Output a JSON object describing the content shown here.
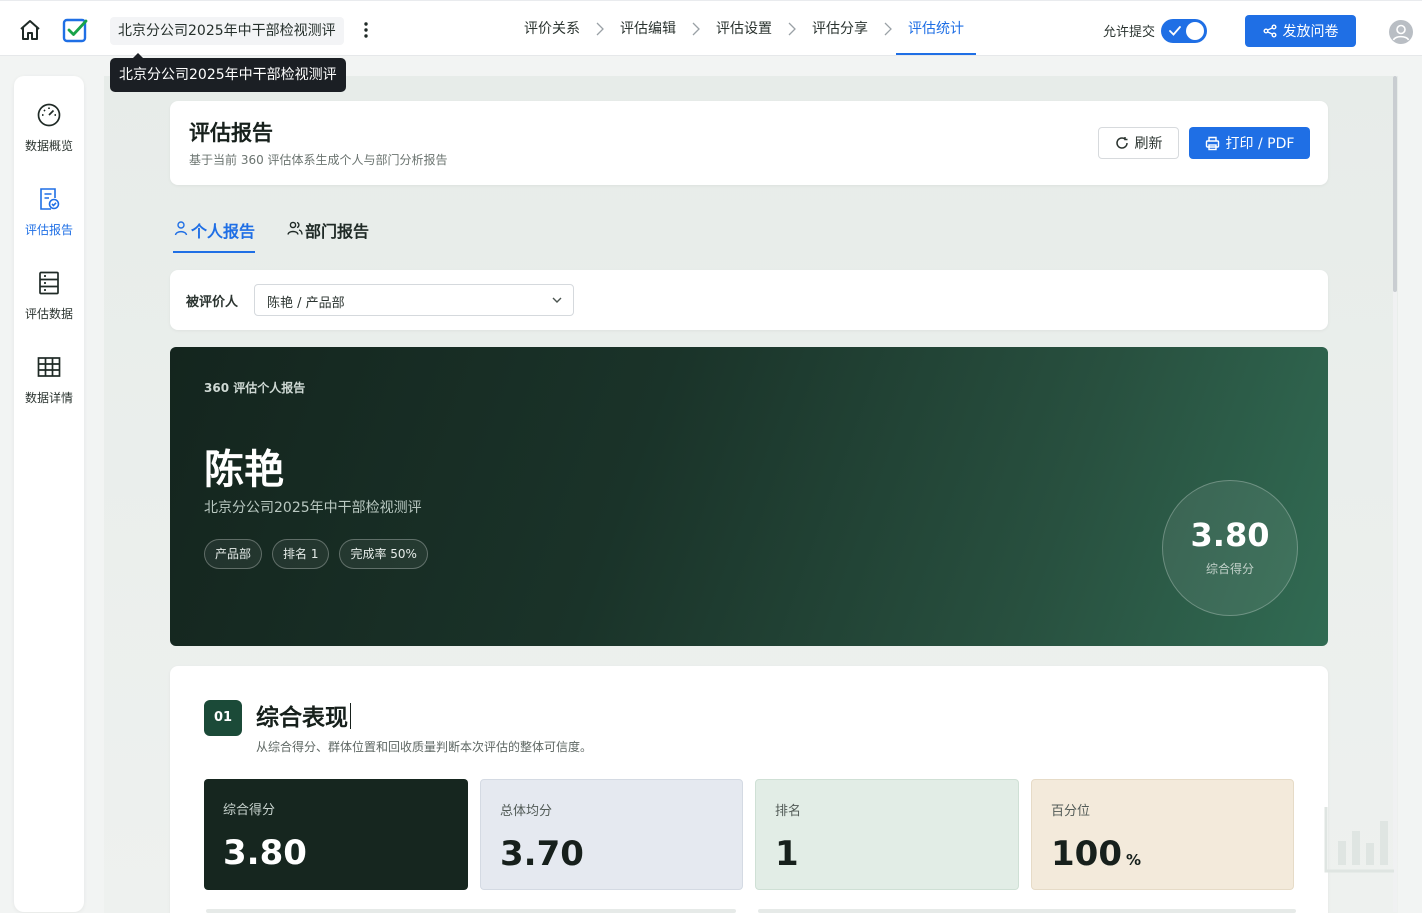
{
  "header": {
    "doc_title": "北京分公司2025年中干部检视测评",
    "steps": [
      "评价关系",
      "评估编辑",
      "评估设置",
      "评估分享",
      "评估统计"
    ],
    "active_step": 4,
    "allow_submit_label": "允许提交",
    "allow_submit_on": true,
    "publish_label": "发放问卷"
  },
  "tooltip": {
    "text": "北京分公司2025年中干部检视测评"
  },
  "sidebar": {
    "items": [
      {
        "label": "数据概览",
        "icon": "gauge-icon"
      },
      {
        "label": "评估报告",
        "icon": "report-icon",
        "active": true
      },
      {
        "label": "评估数据",
        "icon": "data-list-icon"
      },
      {
        "label": "数据详情",
        "icon": "grid-table-icon"
      }
    ]
  },
  "report": {
    "title": "评估报告",
    "subtitle": "基于当前 360 评估体系生成个人与部门分析报告",
    "refresh_label": "刷新",
    "print_label": "打印 / PDF"
  },
  "tabs": [
    {
      "label": "个人报告",
      "active": true
    },
    {
      "label": "部门报告",
      "active": false
    }
  ],
  "filter": {
    "label": "被评价人",
    "selected": "陈艳 / 产品部"
  },
  "hero": {
    "eyebrow": "360 评估个人报告",
    "name": "陈艳",
    "project": "北京分公司2025年中干部检视测评",
    "chips": [
      "产品部",
      "排名 1",
      "完成率 50%"
    ],
    "score": "3.80",
    "score_caption": "综合得分"
  },
  "section": {
    "badge": "01",
    "title": "综合表现",
    "subtitle": "从综合得分、群体位置和回收质量判断本次评估的整体可信度。",
    "metrics": [
      {
        "label": "综合得分",
        "value": "3.80",
        "unit": ""
      },
      {
        "label": "总体均分",
        "value": "3.70",
        "unit": ""
      },
      {
        "label": "排名",
        "value": "1",
        "unit": ""
      },
      {
        "label": "百分位",
        "value": "100",
        "unit": "%"
      }
    ]
  },
  "colors": {
    "accent": "#1f6fe5",
    "hero_dark": "#14251e",
    "badge_green": "#1b4a38"
  }
}
